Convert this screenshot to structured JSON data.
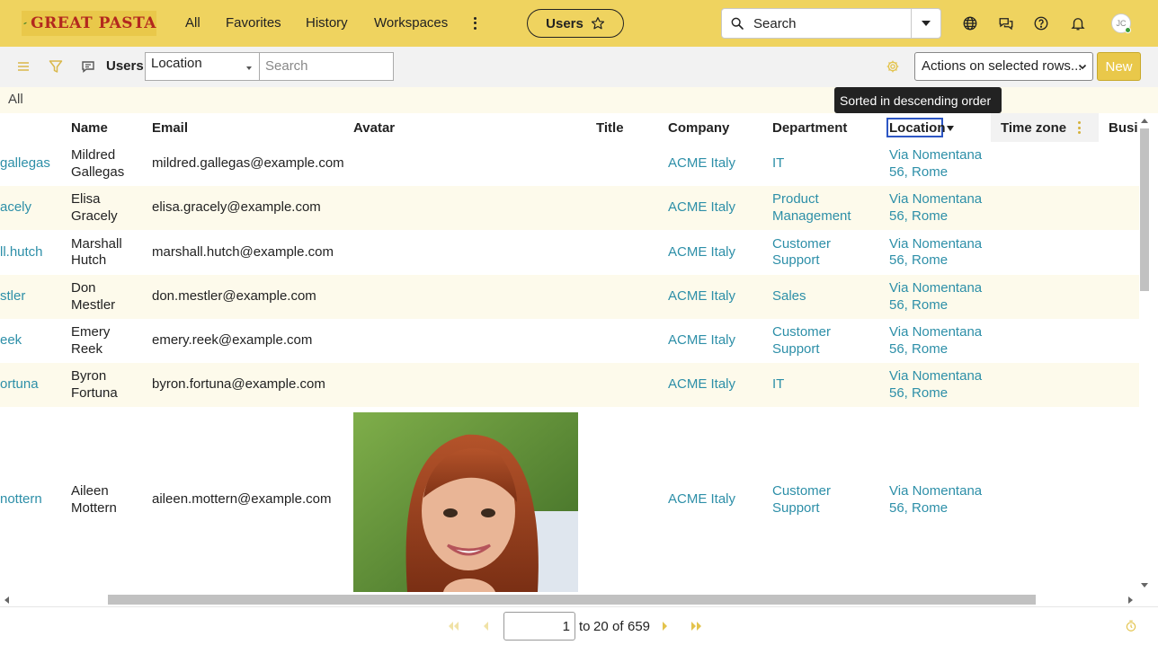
{
  "brand": {
    "name": "Great Pasta",
    "display": "GREAT PASTA"
  },
  "nav": {
    "items": [
      {
        "label": "All"
      },
      {
        "label": "Favorites"
      },
      {
        "label": "History"
      },
      {
        "label": "Workspaces"
      }
    ]
  },
  "current_tab": {
    "label": "Users"
  },
  "global_search": {
    "placeholder": "Search"
  },
  "user": {
    "initials": "JC"
  },
  "toolbar": {
    "title": "Users",
    "filter_field": "Location",
    "search_placeholder": "Search",
    "actions_label": "Actions on selected rows...",
    "new_label": "New"
  },
  "filter": {
    "label": "All"
  },
  "tooltip": {
    "text": "Sorted in descending order"
  },
  "columns": [
    {
      "label": "Name"
    },
    {
      "label": "Email"
    },
    {
      "label": "Avatar"
    },
    {
      "label": "Title"
    },
    {
      "label": "Company"
    },
    {
      "label": "Department"
    },
    {
      "label": "Location"
    },
    {
      "label": "Time zone"
    },
    {
      "label": "Busi"
    }
  ],
  "rows": [
    {
      "user_id": "gallegas",
      "first": "Mildred",
      "last": "Gallegas",
      "email": "mildred.gallegas@example.com",
      "company": "ACME Italy",
      "dept1": "IT",
      "dept2": "",
      "loc1": "Via Nomentana",
      "loc2": "56, Rome"
    },
    {
      "user_id": "acely",
      "first": "Elisa",
      "last": "Gracely",
      "email": "elisa.gracely@example.com",
      "company": "ACME Italy",
      "dept1": "Product",
      "dept2": "Management",
      "loc1": "Via Nomentana",
      "loc2": "56, Rome"
    },
    {
      "user_id": "ll.hutch",
      "first": "Marshall",
      "last": "Hutch",
      "email": "marshall.hutch@example.com",
      "company": "ACME Italy",
      "dept1": "Customer",
      "dept2": "Support",
      "loc1": "Via Nomentana",
      "loc2": "56, Rome"
    },
    {
      "user_id": "stler",
      "first": "Don",
      "last": "Mestler",
      "email": "don.mestler@example.com",
      "company": "ACME Italy",
      "dept1": "Sales",
      "dept2": "",
      "loc1": "Via Nomentana",
      "loc2": "56, Rome"
    },
    {
      "user_id": "eek",
      "first": "Emery",
      "last": "Reek",
      "email": "emery.reek@example.com",
      "company": "ACME Italy",
      "dept1": "Customer",
      "dept2": "Support",
      "loc1": "Via Nomentana",
      "loc2": "56, Rome"
    },
    {
      "user_id": "ortuna",
      "first": "Byron",
      "last": "Fortuna",
      "email": "byron.fortuna@example.com",
      "company": "ACME Italy",
      "dept1": "IT",
      "dept2": "",
      "loc1": "Via Nomentana",
      "loc2": "56, Rome"
    },
    {
      "user_id": "nottern",
      "first": "Aileen",
      "last": "Mottern",
      "email": "aileen.mottern@example.com",
      "company": "ACME Italy",
      "dept1": "Customer",
      "dept2": "Support",
      "loc1": "Via Nomentana",
      "loc2": "56, Rome",
      "has_avatar": true
    }
  ],
  "pager": {
    "page": "1",
    "to_label": "to",
    "to_value": "20",
    "of_label": "of",
    "total": "659"
  },
  "colors": {
    "topbar": "#efd35f",
    "accent": "#e9c84a",
    "link": "#2d8fa8",
    "row_alt": "#fdfaeb",
    "focus": "#2d56c4"
  }
}
